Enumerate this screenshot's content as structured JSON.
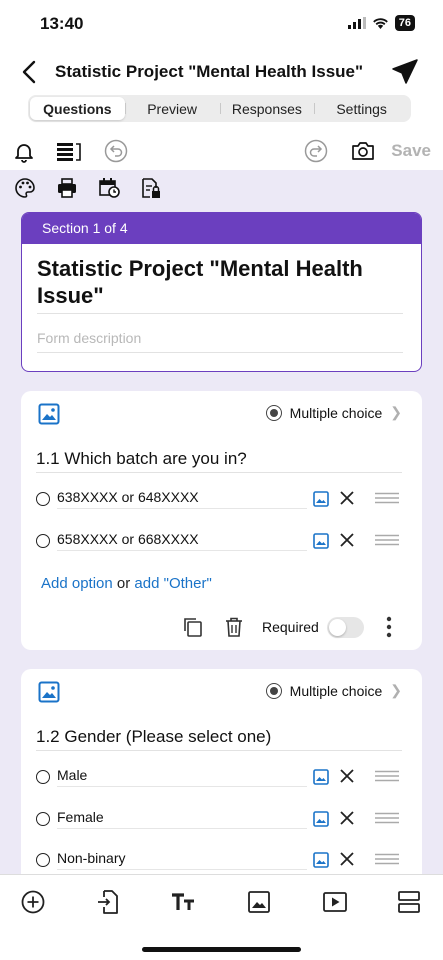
{
  "status_bar": {
    "time": "13:40",
    "battery": "76"
  },
  "header": {
    "title": "Statistic Project \"Mental Health Issue\""
  },
  "tabs": [
    {
      "label": "Questions",
      "active": true
    },
    {
      "label": "Preview",
      "active": false
    },
    {
      "label": "Responses",
      "active": false
    },
    {
      "label": "Settings",
      "active": false
    }
  ],
  "toolbar": {
    "save_label": "Save",
    "icons": [
      "bell-icon",
      "reorder-icon",
      "undo-icon",
      "redo-icon",
      "camera-icon",
      "palette-icon",
      "print-icon",
      "schedule-icon",
      "lock-document-icon"
    ]
  },
  "form": {
    "section_label": "Section 1 of 4",
    "title": "Statistic Project \"Mental Health Issue\"",
    "description_placeholder": "Form description"
  },
  "questions": [
    {
      "type_label": "Multiple choice",
      "title": "1.1  Which batch are you in?",
      "options": [
        "638XXXX or 648XXXX",
        "658XXXX or 668XXXX"
      ],
      "add_option": "Add option",
      "or_text": " or ",
      "add_other": "add \"Other\"",
      "required_label": "Required",
      "required": false
    },
    {
      "type_label": "Multiple choice",
      "title": "1.2  Gender (Please select one)",
      "options": [
        "Male",
        "Female",
        "Non-binary"
      ]
    }
  ],
  "bottom_bar_icons": [
    "add-question-icon",
    "import-questions-icon",
    "title-text-icon",
    "image-icon",
    "video-icon",
    "section-icon"
  ],
  "colors": {
    "accent": "#6b3fbf",
    "link": "#1a73c8",
    "canvas": "#ece9f6"
  }
}
